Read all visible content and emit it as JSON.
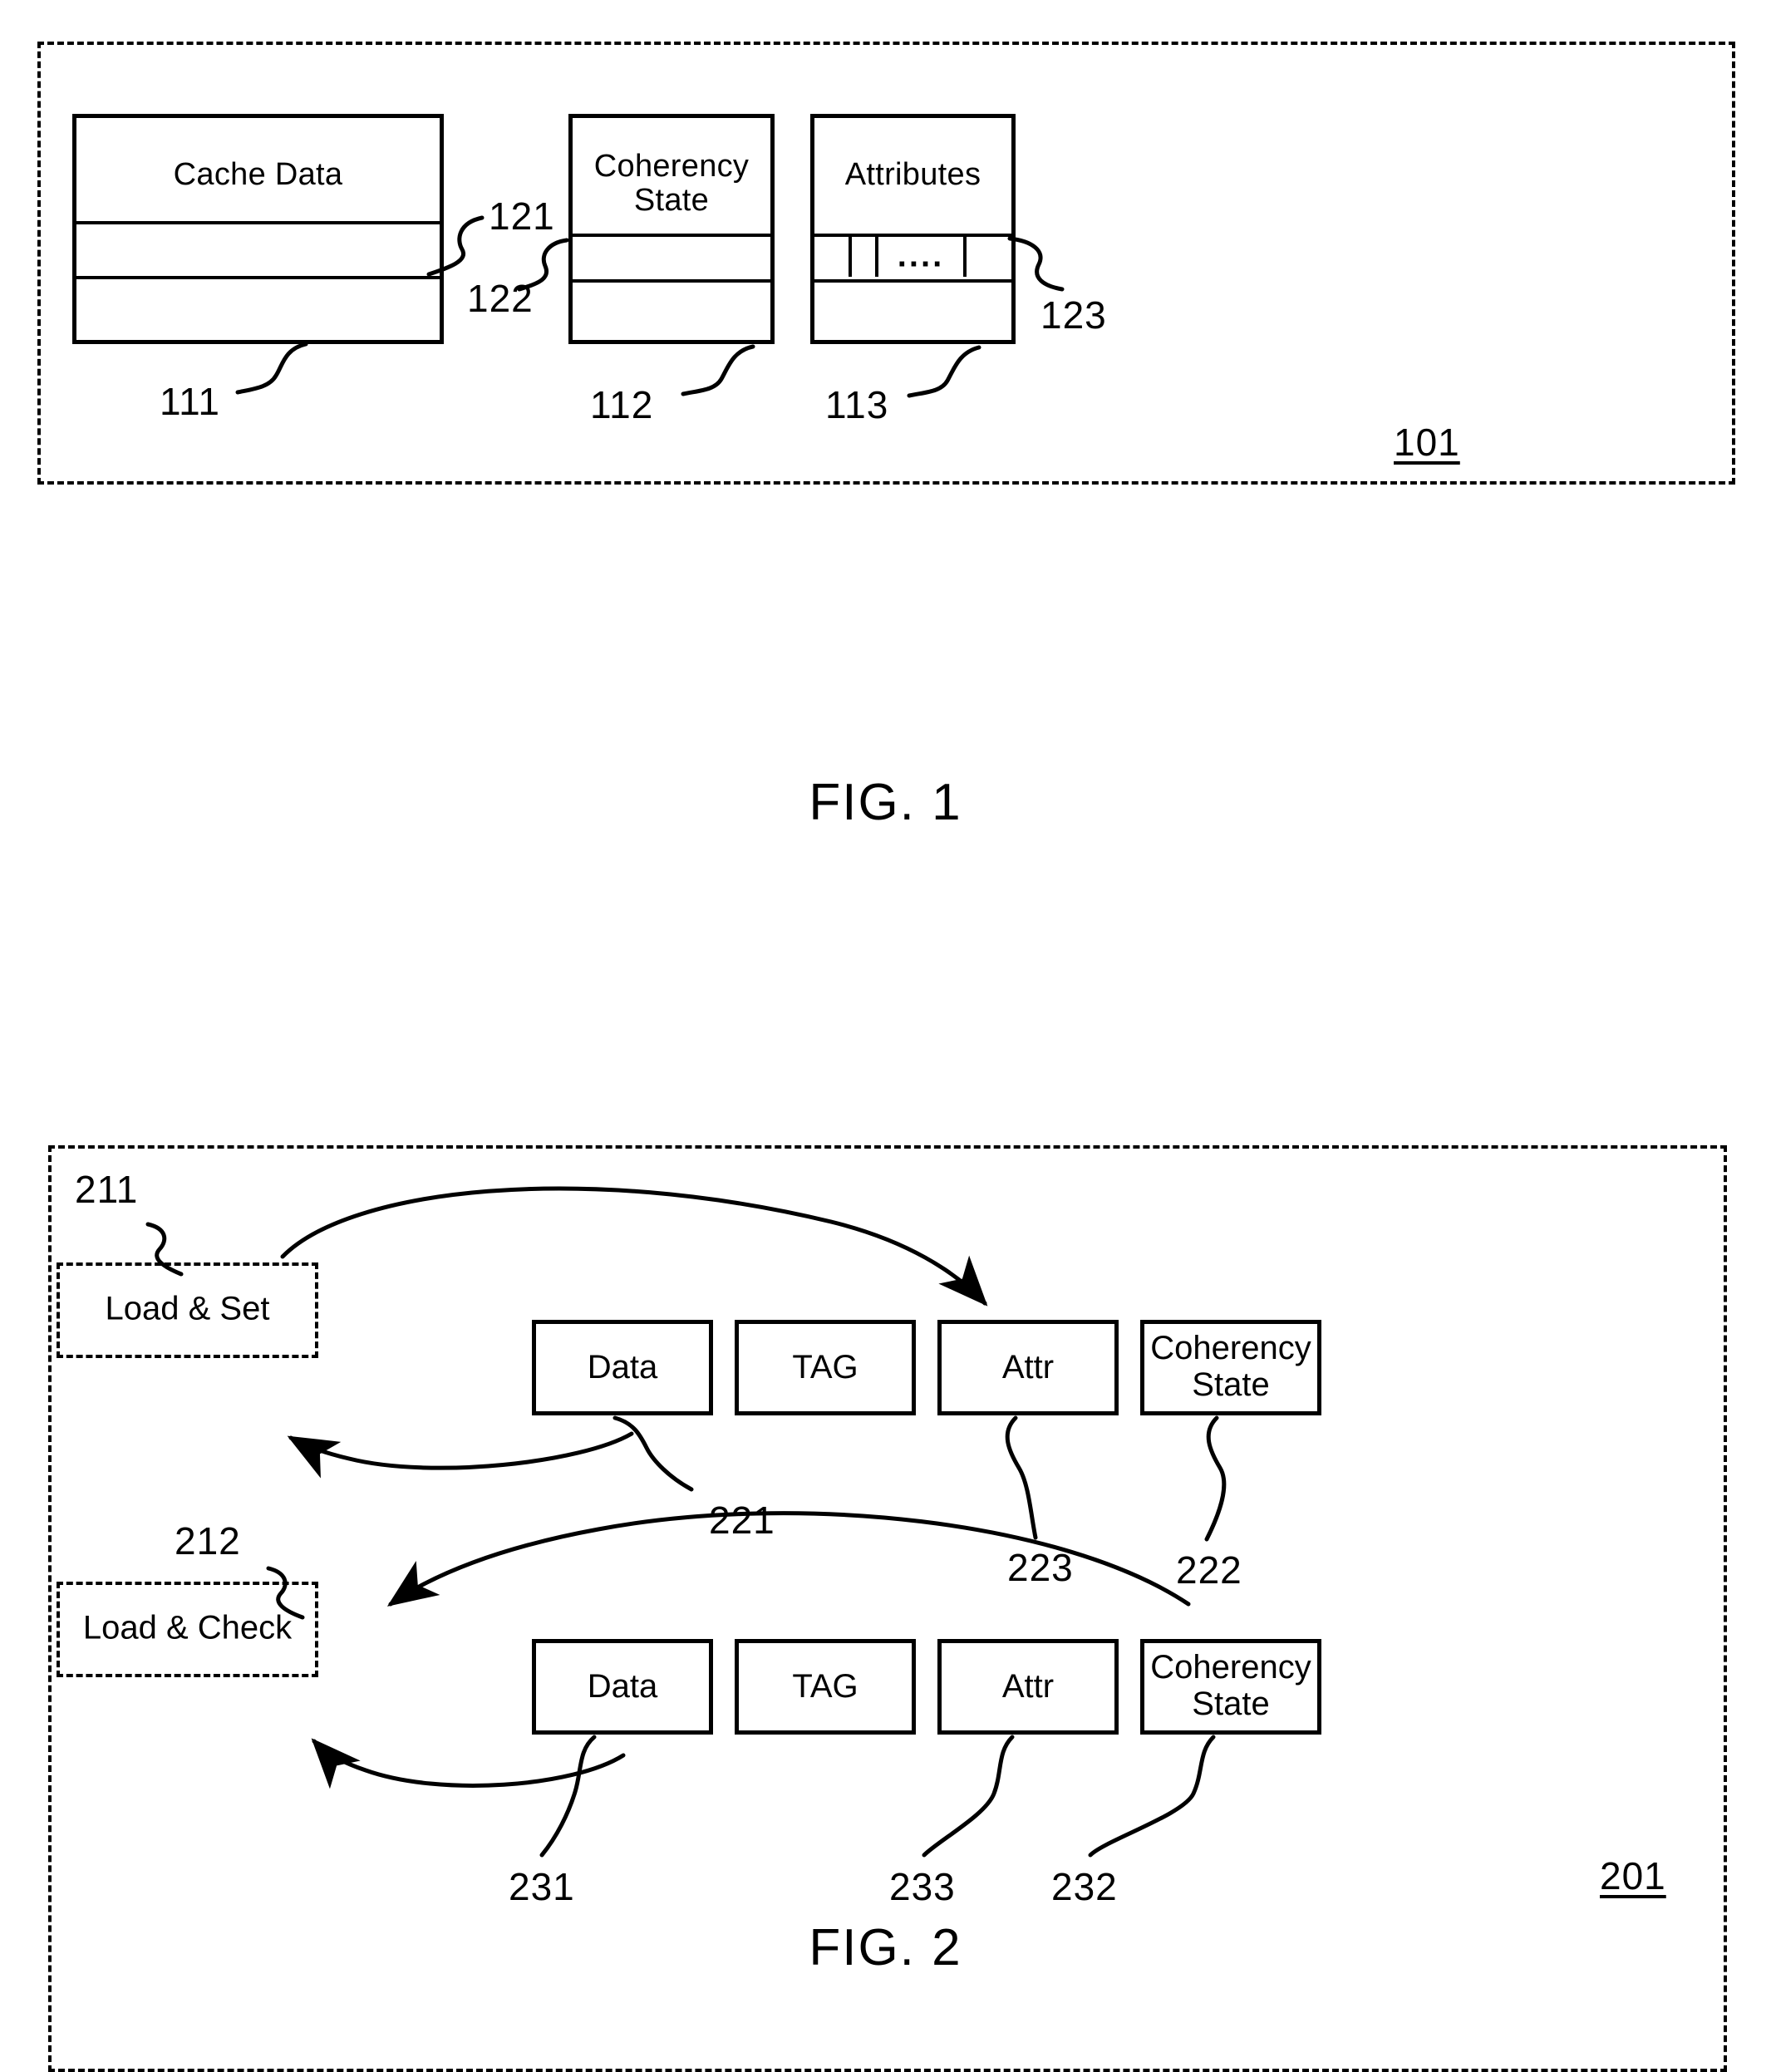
{
  "figures": [
    {
      "id": "fig1",
      "caption": "FIG. 1",
      "frame_ref": "101",
      "boxes": {
        "cache_data": "Cache Data",
        "coherency_state": "Coherency\nState",
        "attributes": "Attributes"
      },
      "attribute_cells": [
        "",
        "",
        "....",
        ""
      ],
      "refs": {
        "r121": "121",
        "r122": "122",
        "r123": "123",
        "r111": "111",
        "r112": "112",
        "r113": "113"
      }
    },
    {
      "id": "fig2",
      "caption": "FIG. 2",
      "frame_ref": "201",
      "processes": {
        "load_set": "Load & Set",
        "load_check": "Load & Check"
      },
      "row1": {
        "data": "Data",
        "tag": "TAG",
        "attr": "Attr",
        "coherency_state_line1": "Coherency",
        "coherency_state_line2": "State"
      },
      "row2": {
        "data": "Data",
        "tag": "TAG",
        "attr": "Attr",
        "coherency_state_line1": "Coherency",
        "coherency_state_line2": "State"
      },
      "refs": {
        "r211": "211",
        "r212": "212",
        "r221": "221",
        "r222": "222",
        "r223": "223",
        "r231": "231",
        "r232": "232",
        "r233": "233"
      }
    }
  ],
  "fig1": {
    "caption": "FIG. 1",
    "frame_ref": "101",
    "cache_data_title": "Cache Data",
    "coherency_title_line1": "Coherency",
    "coherency_title_line2": "State",
    "attributes_title": "Attributes",
    "attr_cell_1": "",
    "attr_cell_2": "",
    "attr_cell_3": "....",
    "attr_cell_4": "",
    "ref_121": "121",
    "ref_122": "122",
    "ref_123": "123",
    "ref_111": "111",
    "ref_112": "112",
    "ref_113": "113"
  },
  "fig2": {
    "caption": "FIG. 2",
    "frame_ref": "201",
    "load_set": "Load & Set",
    "load_check": "Load & Check",
    "row1_data": "Data",
    "row1_tag": "TAG",
    "row1_attr": "Attr",
    "row1_coh_l1": "Coherency",
    "row1_coh_l2": "State",
    "row2_data": "Data",
    "row2_tag": "TAG",
    "row2_attr": "Attr",
    "row2_coh_l1": "Coherency",
    "row2_coh_l2": "State",
    "ref_211": "211",
    "ref_212": "212",
    "ref_221": "221",
    "ref_222": "222",
    "ref_223": "223",
    "ref_231": "231",
    "ref_232": "232",
    "ref_233": "233"
  },
  "colors": {
    "ink": "#000000",
    "paper": "#ffffff"
  }
}
